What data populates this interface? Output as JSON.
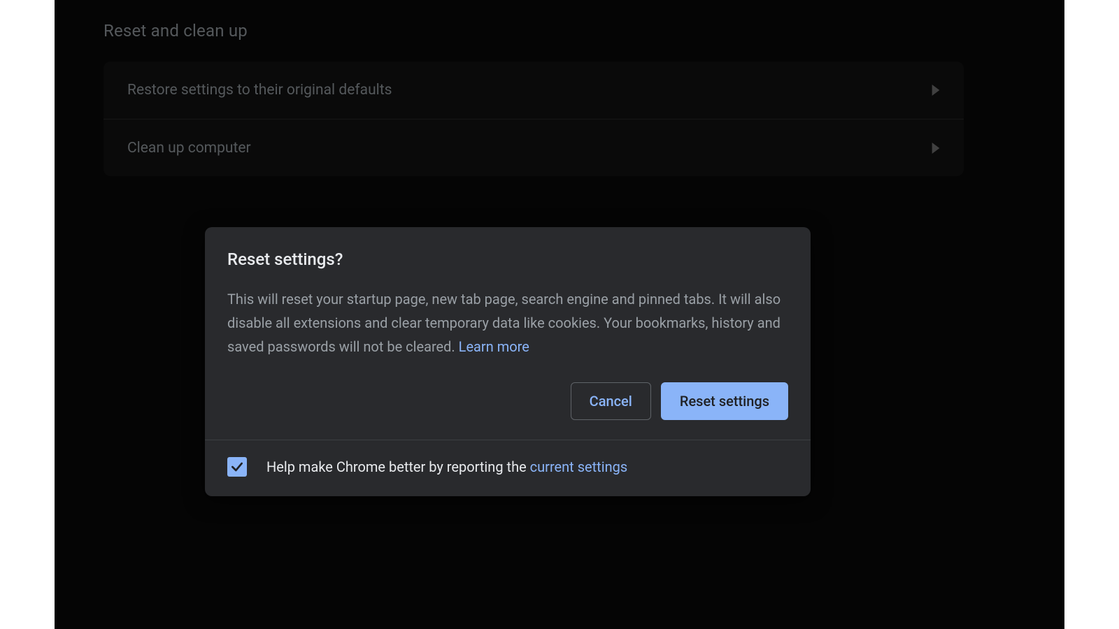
{
  "section": {
    "title": "Reset and clean up",
    "rows": [
      {
        "label": "Restore settings to their original defaults"
      },
      {
        "label": "Clean up computer"
      }
    ]
  },
  "dialog": {
    "title": "Reset settings?",
    "body": "This will reset your startup page, new tab page, search engine and pinned tabs. It will also disable all extensions and clear temporary data like cookies. Your bookmarks, history and saved passwords will not be cleared. ",
    "learn_more": "Learn more",
    "cancel": "Cancel",
    "confirm": "Reset settings",
    "report_prefix": "Help make Chrome better by reporting the ",
    "report_link": "current settings",
    "report_checked": true
  }
}
